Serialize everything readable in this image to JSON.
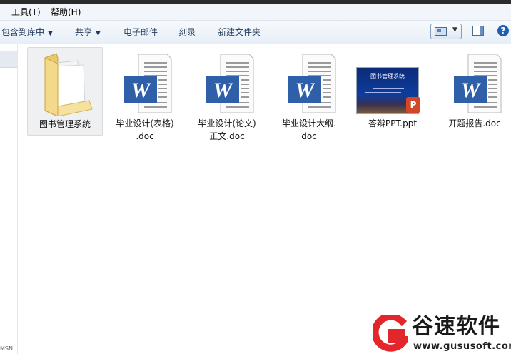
{
  "menu": {
    "tools": "工具(T)",
    "help": "帮助(H)"
  },
  "toolbar": {
    "include_library": "包含到库中",
    "share": "共享",
    "email": "电子邮件",
    "burn": "刻录",
    "new_folder": "新建文件夹"
  },
  "files": [
    {
      "name": "图书管理系统",
      "type": "folder"
    },
    {
      "name": "毕业设计(表格)\n.doc",
      "type": "doc"
    },
    {
      "name": "毕业设计(论文)\n正文.doc",
      "type": "doc"
    },
    {
      "name": "毕业设计大纲.\ndoc",
      "type": "doc"
    },
    {
      "name": "答辩PPT.ppt",
      "type": "ppt",
      "thumb_title": "图书管理系统"
    },
    {
      "name": "开题报告.doc",
      "type": "doc"
    }
  ],
  "nav": {
    "fragment": "MSN"
  },
  "watermark": {
    "name": "谷速软件",
    "url": "www.gususoft.com"
  },
  "colors": {
    "word_blue": "#2f5fa8",
    "ppt_orange": "#d24726",
    "folder_yellow": "#f3d98a",
    "logo_red": "#e3262b"
  }
}
